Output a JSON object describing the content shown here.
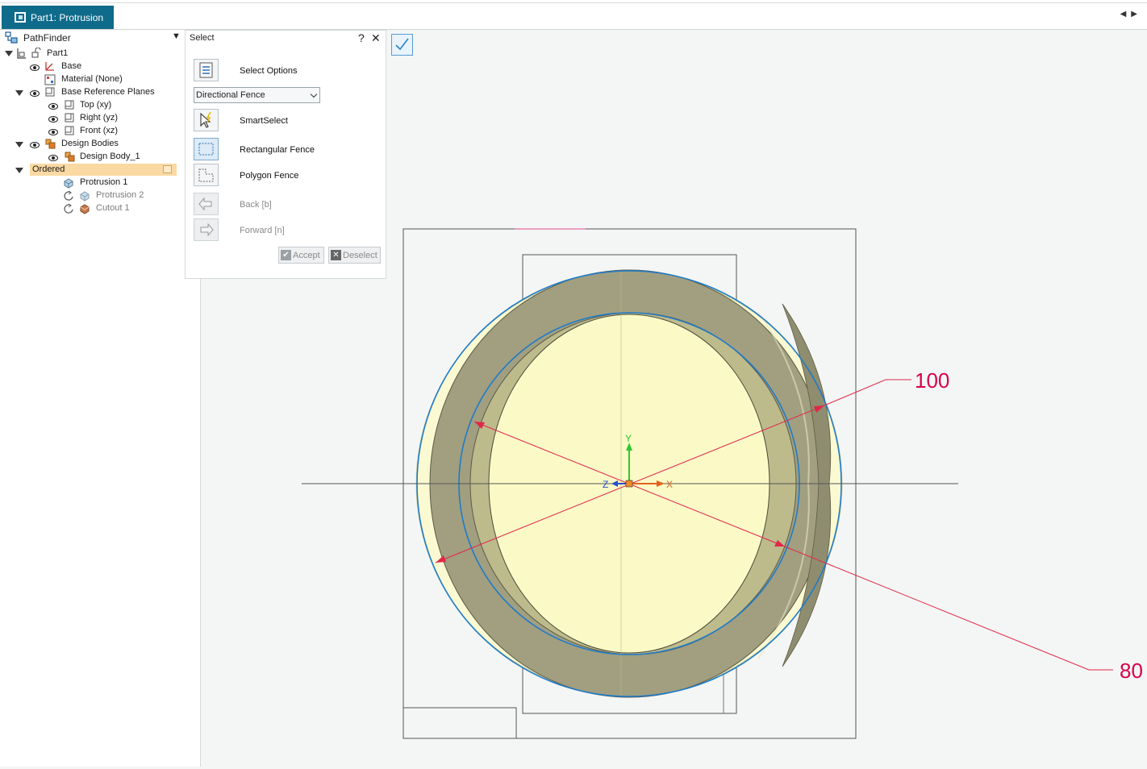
{
  "window": {
    "tab_title": "Part1: Protrusion"
  },
  "pathfinder": {
    "title": "PathFinder",
    "items": [
      {
        "label": "Part1",
        "dim": false
      },
      {
        "label": "Base",
        "dim": false
      },
      {
        "label": "Material (None)",
        "dim": false
      },
      {
        "label": "Base Reference Planes",
        "dim": false
      },
      {
        "label": "Top (xy)",
        "dim": false
      },
      {
        "label": "Right (yz)",
        "dim": false
      },
      {
        "label": "Front (xz)",
        "dim": false
      },
      {
        "label": "Design Bodies",
        "dim": false
      },
      {
        "label": "Design Body_1",
        "dim": false
      },
      {
        "label": "Ordered",
        "dim": false
      },
      {
        "label": "Protrusion 1",
        "dim": false
      },
      {
        "label": "Protrusion 2",
        "dim": true
      },
      {
        "label": "Cutout 1",
        "dim": true
      }
    ]
  },
  "select_panel": {
    "title": "Select",
    "help": "?",
    "close": "✕",
    "options_label": "Select Options",
    "dropdown_value": "Directional Fence",
    "smartselect_label": "SmartSelect",
    "rect_fence_label": "Rectangular Fence",
    "polygon_fence_label": "Polygon Fence",
    "back_label": "Back [b]",
    "forward_label": "Forward [n]",
    "accept_label": "Accept",
    "deselect_label": "Deselect"
  },
  "viewport": {
    "dimensions": [
      {
        "value": "100"
      },
      {
        "value": "80"
      }
    ],
    "triad": {
      "x": "X",
      "y": "Y",
      "z": "Z"
    }
  },
  "colors": {
    "accent": "#0f6b8a",
    "dimension": "#d9004c",
    "edge_blue": "#1f7bc9",
    "ring": "#a19f80",
    "face": "#fafac5",
    "ordered_highlight": "#fbd9a3"
  }
}
